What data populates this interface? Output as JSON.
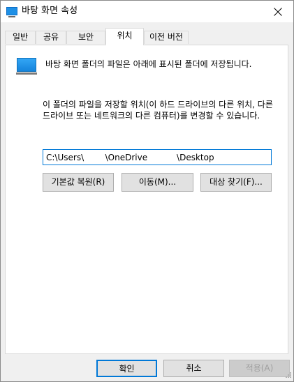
{
  "window": {
    "title": "바탕 화면 속성"
  },
  "tabs": [
    {
      "label": "일반"
    },
    {
      "label": "공유"
    },
    {
      "label": "보안"
    },
    {
      "label": "위치"
    },
    {
      "label": "이전 버전"
    }
  ],
  "active_tab": "위치",
  "panel": {
    "description": "바탕 화면 폴더의 파일은 아래에 표시된 폴더에 저장됩니다.",
    "instruction": "이 폴더의 파일을 저장할 위치(이 하드 드라이브의 다른 위치, 다른 드라이브 또는 네트워크의 다른 컴퓨터)를 변경할 수 있습니다.",
    "path_value": "C:\\Users\\        \\OneDrive           \\Desktop",
    "restore_default_label": "기본값 복원(R)",
    "move_label": "이동(M)...",
    "find_target_label": "대상 찾기(F)..."
  },
  "footer": {
    "ok_label": "확인",
    "cancel_label": "취소",
    "apply_label": "적용(A)"
  },
  "colors": {
    "accent": "#0078d7",
    "folder_blue": "#1e90e6"
  },
  "icons": {
    "title": "desktop-folder-icon",
    "close": "close-icon",
    "panel": "desktop-folder-icon"
  }
}
